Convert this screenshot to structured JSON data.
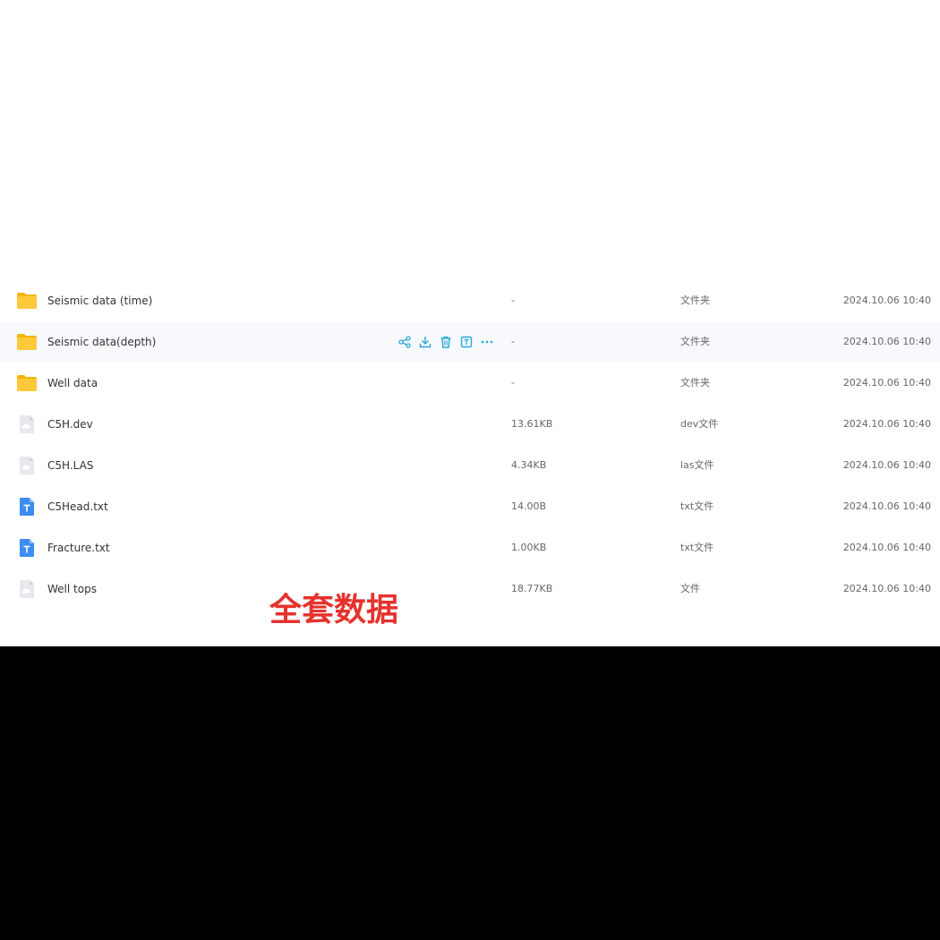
{
  "colors": {
    "folder": "#ffc93c",
    "folder_dark": "#f5b400",
    "txt_icon": "#3d8cf0",
    "generic_icon": "#dcdfe4",
    "action": "#28a8d8",
    "caption": "#e5322d"
  },
  "files": [
    {
      "name": "Seismic data (time)",
      "size": "-",
      "type": "文件夹",
      "date": "2024.10.06 10:40",
      "icon": "folder-icon"
    },
    {
      "name": "Seismic data(depth)",
      "size": "-",
      "type": "文件夹",
      "date": "2024.10.06 10:40",
      "icon": "folder-icon"
    },
    {
      "name": "Well data",
      "size": "-",
      "type": "文件夹",
      "date": "2024.10.06 10:40",
      "icon": "folder-icon"
    },
    {
      "name": "C5H.dev",
      "size": "13.61KB",
      "type": "dev文件",
      "date": "2024.10.06 10:40",
      "icon": "generic-file-icon"
    },
    {
      "name": "C5H.LAS",
      "size": "4.34KB",
      "type": "las文件",
      "date": "2024.10.06 10:40",
      "icon": "generic-file-icon"
    },
    {
      "name": "C5Head.txt",
      "size": "14.00B",
      "type": "txt文件",
      "date": "2024.10.06 10:40",
      "icon": "text-file-icon"
    },
    {
      "name": "Fracture.txt",
      "size": "1.00KB",
      "type": "txt文件",
      "date": "2024.10.06 10:40",
      "icon": "text-file-icon"
    },
    {
      "name": "Well tops",
      "size": "18.77KB",
      "type": "文件",
      "date": "2024.10.06 10:40",
      "icon": "generic-file-icon"
    }
  ],
  "hover_row_actions": [
    "share-icon",
    "download-icon",
    "delete-icon",
    "rename-icon",
    "more-icon"
  ],
  "overlay_caption": "全套数据"
}
